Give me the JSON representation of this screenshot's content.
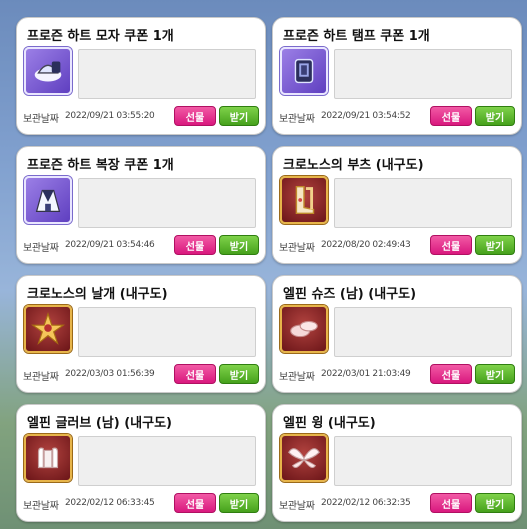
{
  "date_label": "보관날짜",
  "buttons": {
    "gift": "선물",
    "receive": "받기"
  },
  "items": [
    {
      "title": "프로즌 하트 모자 쿠폰 1개",
      "date": "2022/09/21 03:55:20",
      "icon": "frozen-heart-hat-coupon-icon",
      "icon_style": "blue"
    },
    {
      "title": "프로즌 하트 탬프 쿠폰 1개",
      "date": "2022/09/21 03:54:52",
      "icon": "frozen-heart-tamp-coupon-icon",
      "icon_style": "blue"
    },
    {
      "title": "프로즌 하트 복장 쿠폰 1개",
      "date": "2022/09/21 03:54:46",
      "icon": "frozen-heart-outfit-coupon-icon",
      "icon_style": "blue"
    },
    {
      "title": "크로노스의 부츠 (내구도)",
      "date": "2022/08/20 02:49:43",
      "icon": "chronos-boots-icon",
      "icon_style": "gold"
    },
    {
      "title": "크로노스의 날개 (내구도)",
      "date": "2022/03/03 01:56:39",
      "icon": "chronos-wings-icon",
      "icon_style": "gold"
    },
    {
      "title": "엘핀 슈즈 (남) (내구도)",
      "date": "2022/03/01 21:03:49",
      "icon": "elfin-shoes-icon",
      "icon_style": "gold"
    },
    {
      "title": "엘핀 글러브 (남) (내구도)",
      "date": "2022/02/12 06:33:45",
      "icon": "elfin-gloves-icon",
      "icon_style": "gold"
    },
    {
      "title": "엘핀 윙 (내구도)",
      "date": "2022/02/12 06:32:35",
      "icon": "elfin-wing-icon",
      "icon_style": "gold"
    }
  ]
}
